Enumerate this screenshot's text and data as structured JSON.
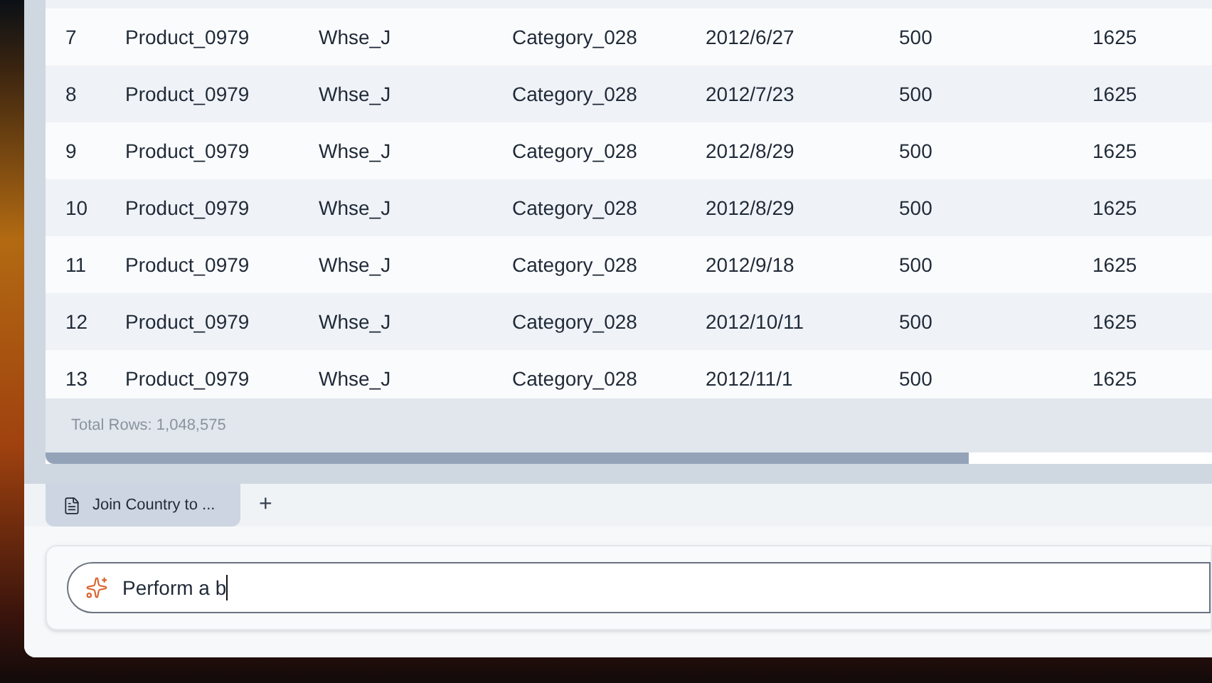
{
  "table": {
    "rows": [
      {
        "cells": [
          "7",
          "Product_0979",
          "Whse_J",
          "Category_028",
          "2012/6/27",
          "500",
          "1625"
        ]
      },
      {
        "cells": [
          "8",
          "Product_0979",
          "Whse_J",
          "Category_028",
          "2012/7/23",
          "500",
          "1625"
        ]
      },
      {
        "cells": [
          "9",
          "Product_0979",
          "Whse_J",
          "Category_028",
          "2012/8/29",
          "500",
          "1625"
        ]
      },
      {
        "cells": [
          "10",
          "Product_0979",
          "Whse_J",
          "Category_028",
          "2012/8/29",
          "500",
          "1625"
        ]
      },
      {
        "cells": [
          "11",
          "Product_0979",
          "Whse_J",
          "Category_028",
          "2012/9/18",
          "500",
          "1625"
        ]
      },
      {
        "cells": [
          "12",
          "Product_0979",
          "Whse_J",
          "Category_028",
          "2012/10/11",
          "500",
          "1625"
        ]
      },
      {
        "cells": [
          "13",
          "Product_0979",
          "Whse_J",
          "Category_028",
          "2012/11/1",
          "500",
          "1625"
        ]
      }
    ],
    "total_rows": "Total Rows: 1,048,575"
  },
  "tabs": [
    {
      "label": "Join Country to ...",
      "selected": true
    }
  ],
  "add_tab": "+",
  "prompt": {
    "value": "Perform a b"
  }
}
